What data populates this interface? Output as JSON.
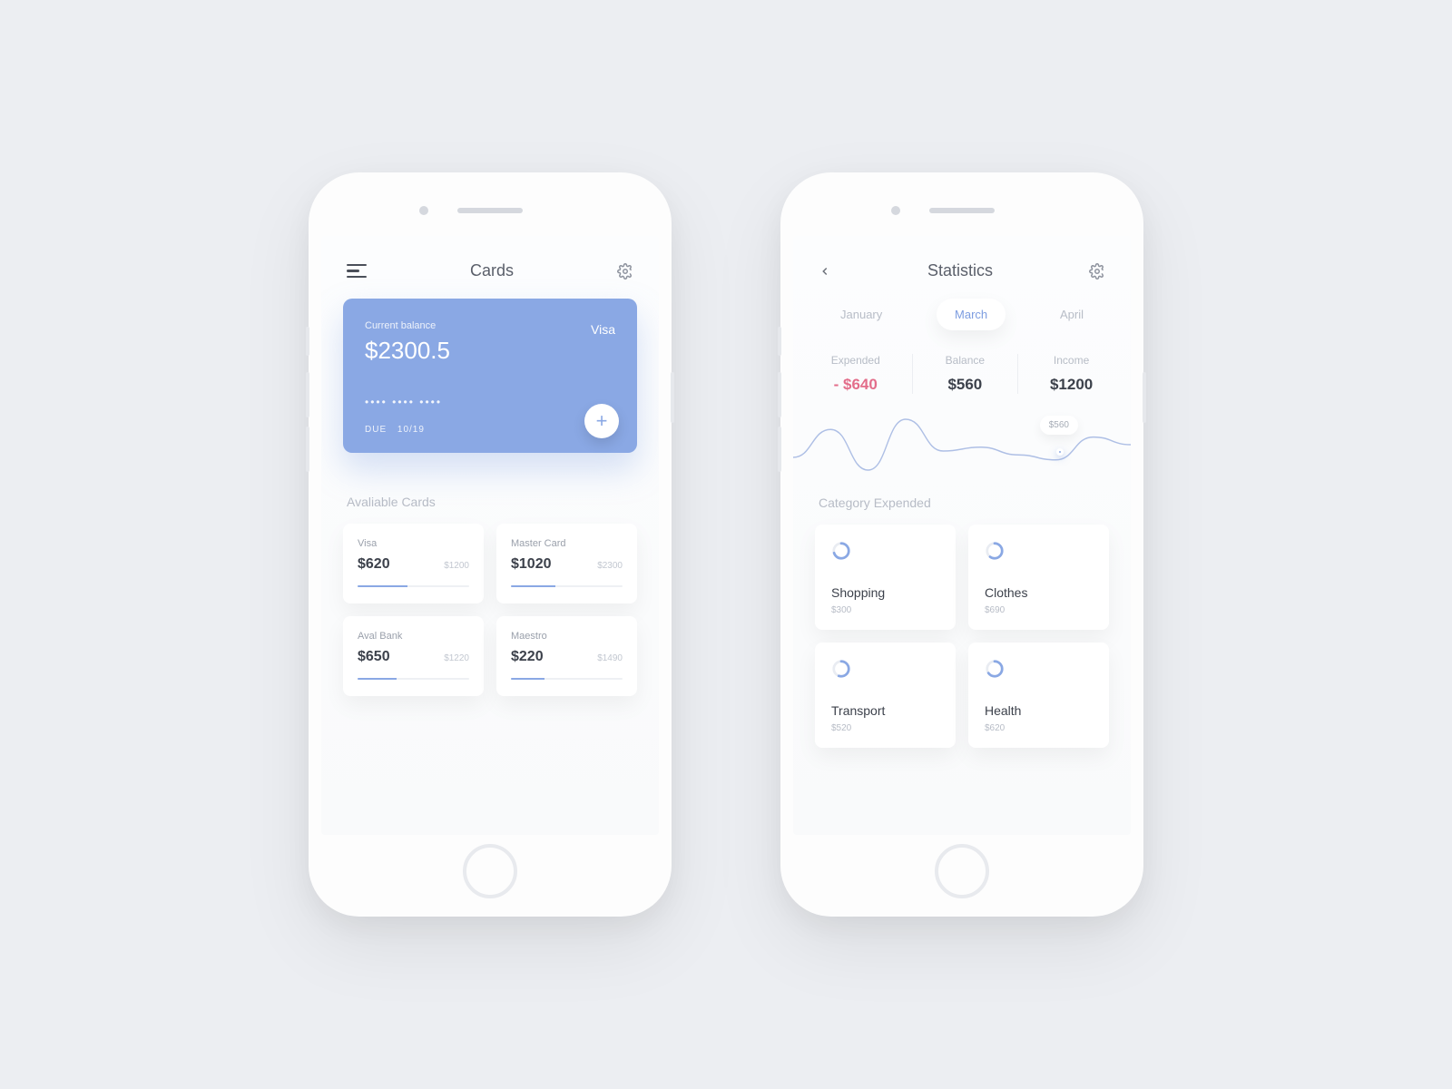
{
  "left": {
    "header_title": "Cards",
    "card": {
      "balance_label": "Current balance",
      "balance_value": "$2300.5",
      "brand": "Visa",
      "masked": "••••   ••••   ••••",
      "due_label": "DUE",
      "due_value": "10/19"
    },
    "avail_label": "Avaliable Cards",
    "cards": [
      {
        "name": "Visa",
        "value": "$620",
        "limit": "$1200",
        "pct": 45
      },
      {
        "name": "Master Card",
        "value": "$1020",
        "limit": "$2300",
        "pct": 40
      },
      {
        "name": "Aval Bank",
        "value": "$650",
        "limit": "$1220",
        "pct": 35
      },
      {
        "name": "Maestro",
        "value": "$220",
        "limit": "$1490",
        "pct": 30
      }
    ]
  },
  "right": {
    "header_title": "Statistics",
    "tabs": [
      "January",
      "March",
      "April"
    ],
    "active_tab": "March",
    "stats": {
      "expended_label": "Expended",
      "expended_value": "- $640",
      "balance_label": "Balance",
      "balance_value": "$560",
      "income_label": "Income",
      "income_value": "$1200"
    },
    "tooltip": "$560",
    "cat_label": "Category Expended",
    "categories": [
      {
        "name": "Shopping",
        "value": "$300",
        "pct": 70
      },
      {
        "name": "Clothes",
        "value": "$690",
        "pct": 60
      },
      {
        "name": "Transport",
        "value": "$520",
        "pct": 55
      },
      {
        "name": "Health",
        "value": "$620",
        "pct": 65
      }
    ]
  },
  "chart_data": {
    "type": "line",
    "title": "",
    "xlabel": "",
    "ylabel": "",
    "x": [
      0,
      1,
      2,
      3,
      4,
      5,
      6,
      7,
      8,
      9
    ],
    "values": [
      400,
      620,
      300,
      700,
      450,
      480,
      420,
      380,
      560,
      500
    ],
    "highlight": {
      "index": 8,
      "label": "$560"
    }
  }
}
